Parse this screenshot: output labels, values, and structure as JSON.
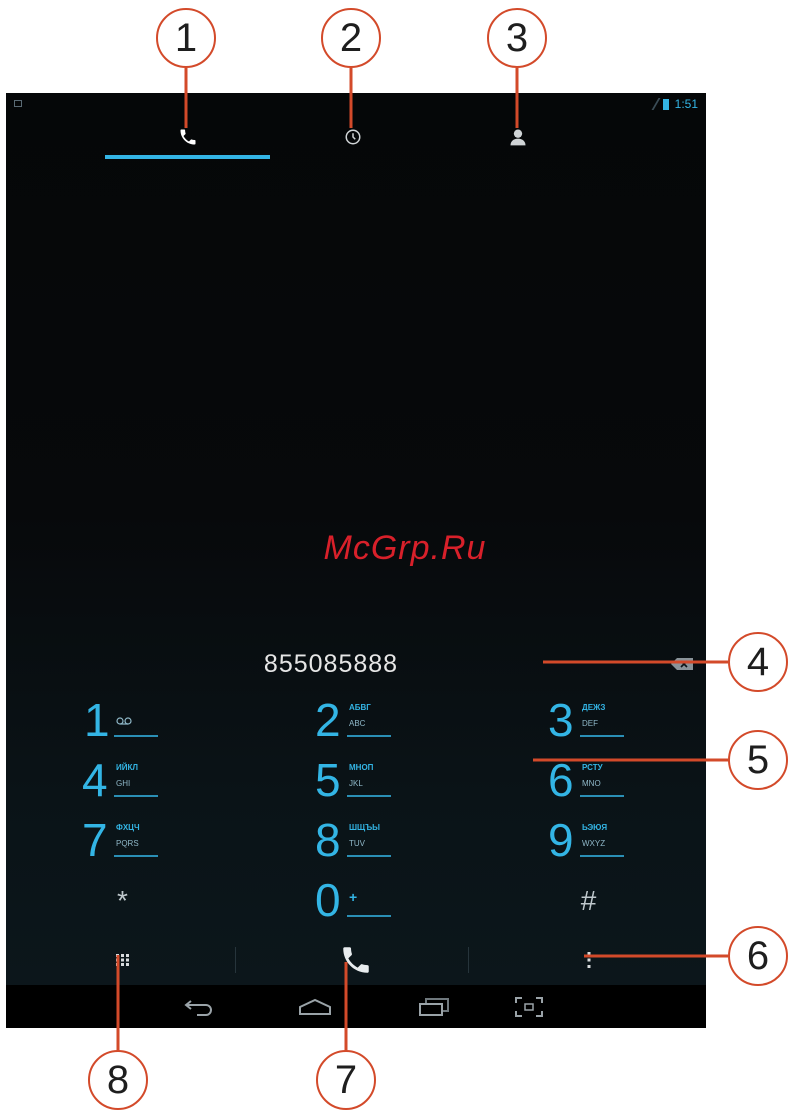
{
  "status_bar": {
    "time": "1:51"
  },
  "tabs": [
    {
      "name": "dialer",
      "icon": "phone-icon",
      "selected": true
    },
    {
      "name": "recent",
      "icon": "clock-icon",
      "selected": false
    },
    {
      "name": "contacts",
      "icon": "person-icon",
      "selected": false
    }
  ],
  "watermark": "McGrp.Ru",
  "digits": "855085888",
  "dialpad": [
    {
      "digit": "1",
      "line1": "",
      "line2": "",
      "voicemail": true
    },
    {
      "digit": "2",
      "line1": "АБВГ",
      "line2": "ABC"
    },
    {
      "digit": "3",
      "line1": "ДЕЖЗ",
      "line2": "DEF"
    },
    {
      "digit": "4",
      "line1": "ИЙКЛ",
      "line2": "GHI"
    },
    {
      "digit": "5",
      "line1": "МНОП",
      "line2": "JKL"
    },
    {
      "digit": "6",
      "line1": "РСТУ",
      "line2": "MNO"
    },
    {
      "digit": "7",
      "line1": "ФХЦЧ",
      "line2": "PQRS"
    },
    {
      "digit": "8",
      "line1": "ШЩЪЫ",
      "line2": "TUV"
    },
    {
      "digit": "9",
      "line1": "ЬЭЮЯ",
      "line2": "WXYZ"
    },
    {
      "digit": "*"
    },
    {
      "digit": "0",
      "line1": "+",
      "line2": ""
    },
    {
      "digit": "#"
    }
  ],
  "colors": {
    "accent": "#33b5e5",
    "callout": "#d34a2a",
    "watermark": "#d8202a"
  },
  "callouts": [
    "1",
    "2",
    "3",
    "4",
    "5",
    "6",
    "7",
    "8"
  ]
}
